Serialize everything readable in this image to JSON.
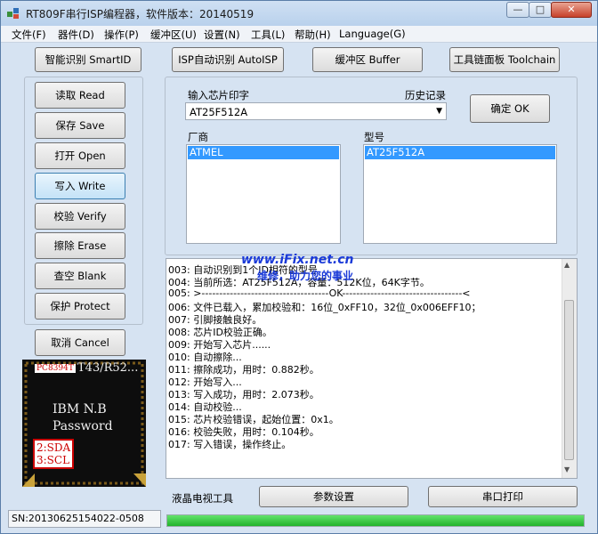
{
  "window": {
    "title": "RT809F串行ISP编程器，软件版本：20140519"
  },
  "menu": [
    "文件(F)",
    "器件(D)",
    "操作(P)",
    "缓冲区(U)",
    "设置(N)",
    "工具(L)",
    "帮助(H)",
    "Language(G)"
  ],
  "top_buttons": [
    "智能识别 SmartID",
    "ISP自动识别 AutoISP",
    "缓冲区 Buffer",
    "工具链面板 Toolchain"
  ],
  "side_buttons": [
    "读取 Read",
    "保存 Save",
    "打开 Open",
    "写入 Write",
    "校验 Verify",
    "擦除 Erase",
    "查空 Blank",
    "保护 Protect"
  ],
  "cancel_button": "取消 Cancel",
  "chip_selector": {
    "input_label": "输入芯片印字",
    "history_label": "历史记录",
    "input_value": "AT25F512A",
    "ok_button": "确定 OK",
    "vendor_label": "厂商",
    "vendor_selected": "ATMEL",
    "model_label": "型号",
    "model_selected": "AT25F512A"
  },
  "chip_image": {
    "tag": "PC8394T",
    "line1": "T43/R52...",
    "line2": "IBM  N.B",
    "line3": "Password",
    "pin1": "2:SDA",
    "pin2": "3:SCL"
  },
  "watermark": {
    "line1": "www.iFix.net.cn",
    "line2": "维修，助力您的事业"
  },
  "log": [
    "003: 自动识别到1个ID相符的型号",
    "004: 当前所选：AT25F512A，容量：512K位，64K字节。",
    "005: >------------------------------------OK----------------------------------<",
    "006: 文件已载入，累加校验和：16位_0xFF10，32位_0x006EFF10；",
    "007: 引脚接触良好。",
    "008: 芯片ID校验正确。",
    "009: 开始写入芯片......",
    "010: 自动擦除...",
    "011: 擦除成功，用时：0.882秒。",
    "012: 开始写入...",
    "013: 写入成功，用时：2.073秒。",
    "014: 自动校验...",
    "015: 芯片校验错误，起始位置：0x1。",
    "016: 校验失败，用时：0.104秒。",
    "017: 写入错误，操作终止。"
  ],
  "bottom": {
    "lcd_tool": "液晶电视工具",
    "param_button": "参数设置",
    "serial_button": "串口打印"
  },
  "status": {
    "sn": "SN:20130625154022-0508",
    "progress": 1.0
  }
}
